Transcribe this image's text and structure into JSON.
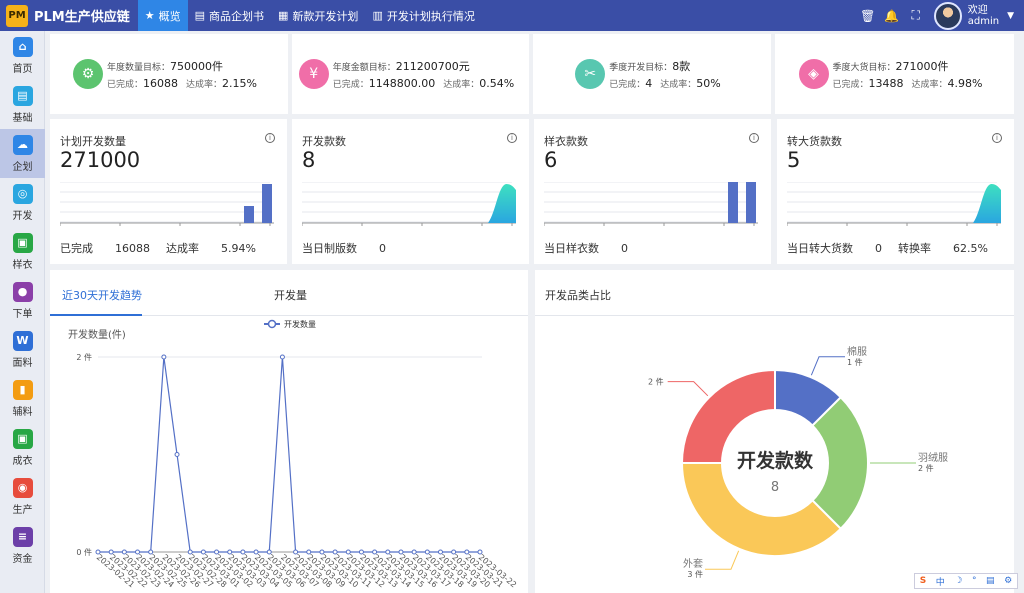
{
  "header": {
    "logo": "PM",
    "app_title": "PLM生产供应链",
    "nav": [
      {
        "label": "概览",
        "icon": "★",
        "active": true
      },
      {
        "label": "商品企划书",
        "icon": "▤"
      },
      {
        "label": "新款开发计划",
        "icon": "▦"
      },
      {
        "label": "开发计划执行情况",
        "icon": "▥"
      }
    ],
    "welcome": "欢迎",
    "user": "admin"
  },
  "sidebar": {
    "items": [
      {
        "label": "首页",
        "icon": "⌂",
        "color": "#2f86e6"
      },
      {
        "label": "基础",
        "icon": "▤",
        "color": "#2aa6e0"
      },
      {
        "label": "企划",
        "icon": "☁",
        "color": "#2f86e6",
        "active": true
      },
      {
        "label": "开发",
        "icon": "◎",
        "color": "#2aa6e0"
      },
      {
        "label": "样衣",
        "icon": "▣",
        "color": "#28a745"
      },
      {
        "label": "下单",
        "icon": "●",
        "color": "#8b3fa8"
      },
      {
        "label": "面料",
        "icon": "W",
        "color": "#2f6fd6"
      },
      {
        "label": "辅料",
        "icon": "▮",
        "color": "#f39c12"
      },
      {
        "label": "成衣",
        "icon": "▣",
        "color": "#28a745"
      },
      {
        "label": "生产",
        "icon": "◉",
        "color": "#e74c3c"
      },
      {
        "label": "资金",
        "icon": "≡",
        "color": "#6c3fa8"
      }
    ]
  },
  "kpis": [
    {
      "target_label": "年度数量目标：",
      "target_value": "750000件",
      "done_label": "已完成：",
      "done_value": "16088",
      "rate_label": "达成率：",
      "rate_value": "2.15%",
      "icon": "⚙",
      "color": "#5cc46f"
    },
    {
      "target_label": "年度金额目标：",
      "target_value": "211200700元",
      "done_label": "已完成：",
      "done_value": "1148800.00",
      "rate_label": "达成率：",
      "rate_value": "0.54%",
      "icon": "¥",
      "color": "#f06ea8"
    },
    {
      "target_label": "季度开发目标：",
      "target_value": "8款",
      "done_label": "已完成：",
      "done_value": "4",
      "rate_label": "达成率：",
      "rate_value": "50%",
      "icon": "✂",
      "color": "#58c7b0"
    },
    {
      "target_label": "季度大货目标：",
      "target_value": "271000件",
      "done_label": "已完成：",
      "done_value": "13488",
      "rate_label": "达成率：",
      "rate_value": "4.98%",
      "icon": "◈",
      "color": "#f06ea8"
    }
  ],
  "stats": [
    {
      "title": "计划开发数量",
      "value": "271000",
      "foot": [
        {
          "label": "已完成",
          "value": "16088"
        },
        {
          "label": "达成率",
          "value": "5.94%"
        }
      ],
      "mini": "bar2"
    },
    {
      "title": "开发款数",
      "value": "8",
      "foot": [
        {
          "label": "当日制版数",
          "value": "0"
        }
      ],
      "mini": "area"
    },
    {
      "title": "样衣款数",
      "value": "6",
      "foot": [
        {
          "label": "当日样衣数",
          "value": "0"
        }
      ],
      "mini": "bar2b"
    },
    {
      "title": "转大货款数",
      "value": "5",
      "foot": [
        {
          "label": "当日转大货数",
          "value": "0"
        },
        {
          "label": "转换率",
          "value": "62.5%"
        }
      ],
      "mini": "area"
    }
  ],
  "trend_panel": {
    "tabs": [
      "近30天开发趋势",
      "开发量"
    ],
    "legend": "开发数量",
    "y_title": "开发数量(件)"
  },
  "pie_panel": {
    "title": "开发品类占比",
    "center_title": "开发款数",
    "center_value": "8"
  },
  "chart_data": [
    {
      "type": "line",
      "title": "",
      "ylabel": "开发数量(件)",
      "ylim": [
        0,
        2
      ],
      "y_ticks": [
        "0 件",
        "2 件"
      ],
      "legend": [
        "开发数量"
      ],
      "x": [
        "2023-02-21",
        "2023-02-22",
        "2023-02-23",
        "2023-02-24",
        "2023-02-25",
        "2023-02-26",
        "2023-02-27",
        "2023-02-28",
        "2023-03-01",
        "2023-03-02",
        "2023-03-03",
        "2023-03-04",
        "2023-03-05",
        "2023-03-06",
        "2023-03-07",
        "2023-03-08",
        "2023-03-09",
        "2023-03-10",
        "2023-03-11",
        "2023-03-12",
        "2023-03-13",
        "2023-03-14",
        "2023-03-15",
        "2023-03-16",
        "2023-03-17",
        "2023-03-18",
        "2023-03-19",
        "2023-03-20",
        "2023-03-21",
        "2023-03-22"
      ],
      "series": [
        {
          "name": "开发数量",
          "values": [
            0,
            0,
            0,
            0,
            0,
            2,
            1,
            0,
            0,
            0,
            0,
            0,
            0,
            0,
            2,
            0,
            0,
            0,
            0,
            0,
            0,
            0,
            0,
            0,
            0,
            0,
            0,
            0,
            0,
            0
          ]
        }
      ]
    },
    {
      "type": "pie",
      "title": "开发品类占比",
      "slices": [
        {
          "name": "棉服",
          "value": 1,
          "label": "1 件",
          "color": "#5470c6"
        },
        {
          "name": "羽绒服",
          "value": 2,
          "label": "2 件",
          "color": "#91cc75"
        },
        {
          "name": "外套",
          "value": 3,
          "label": "3 件",
          "color": "#fac858"
        },
        {
          "name": "",
          "value": 2,
          "label": "2 件",
          "color": "#ee6666"
        }
      ]
    }
  ],
  "toolbar": {
    "items": [
      "中",
      "☽",
      "°",
      "▤",
      "⚙"
    ]
  }
}
